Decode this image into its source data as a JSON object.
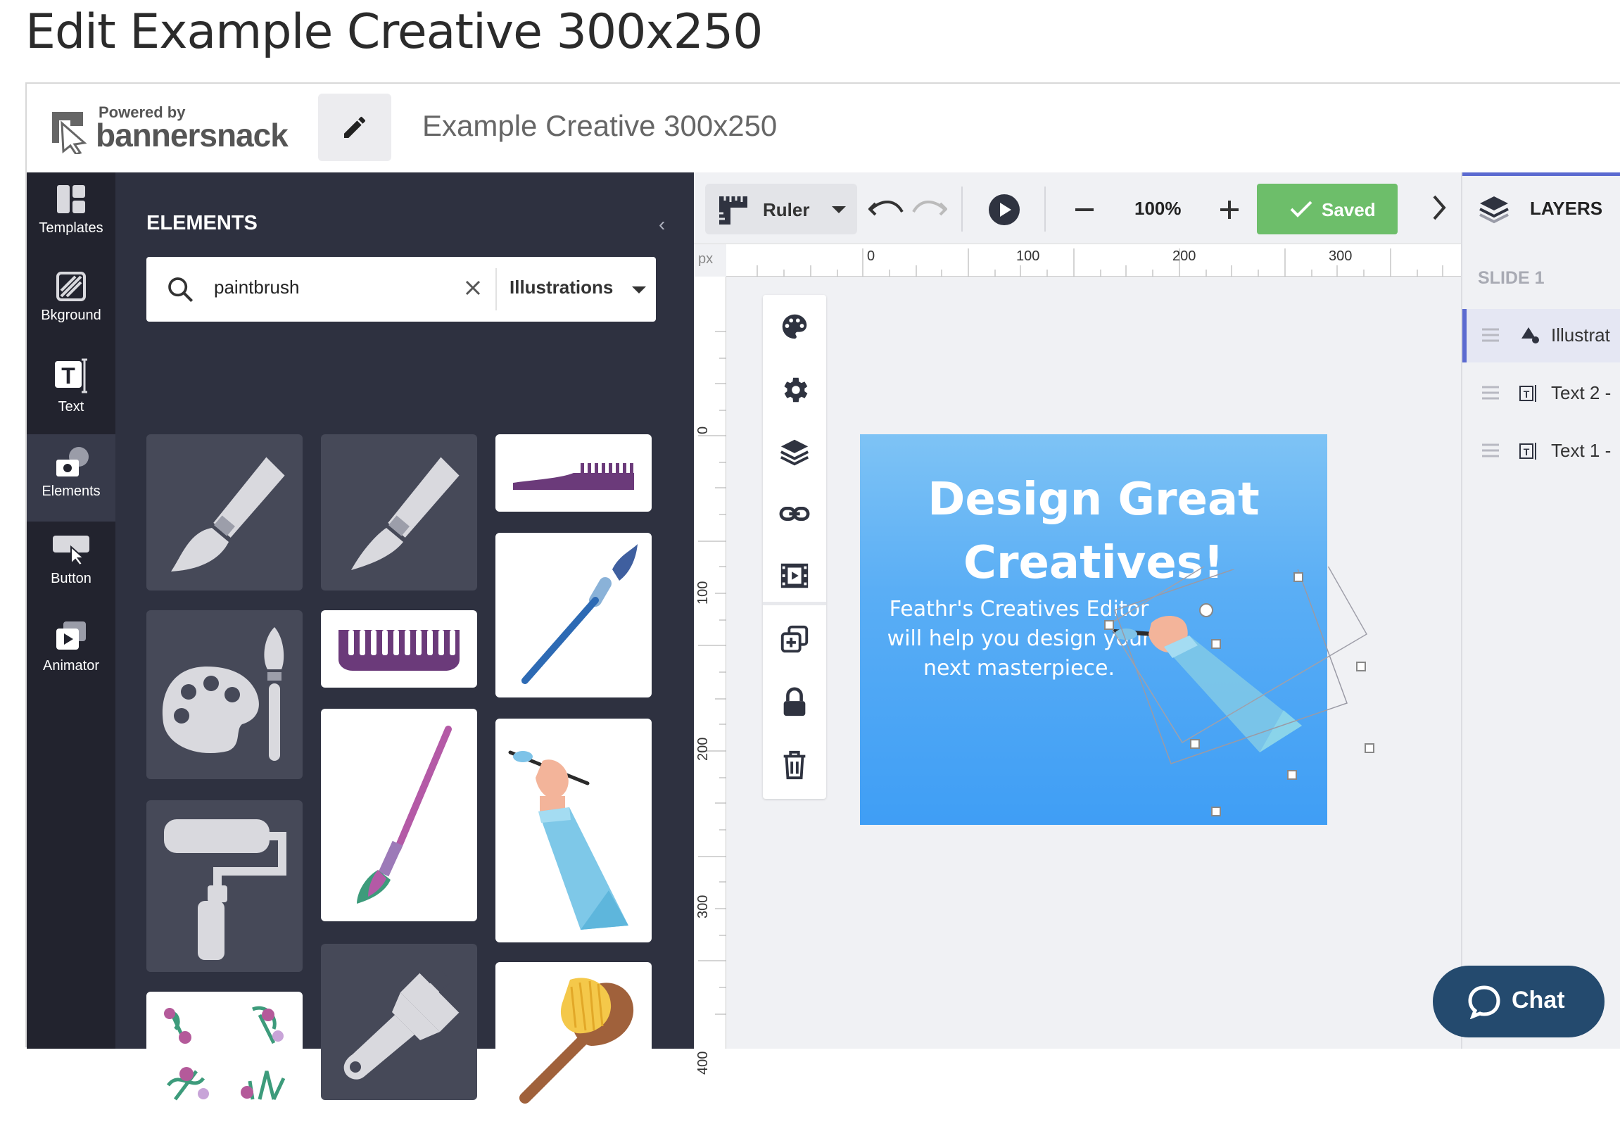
{
  "page": {
    "title": "Edit Example Creative 300x250"
  },
  "header": {
    "logo_powered": "Powered by",
    "logo_name": "bannersnack",
    "creative_name": "Example Creative 300x250"
  },
  "rail": {
    "items": [
      {
        "label": "Templates",
        "icon": "templates-icon"
      },
      {
        "label": "Bkground",
        "icon": "background-icon"
      },
      {
        "label": "Text",
        "icon": "text-icon"
      },
      {
        "label": "Elements",
        "icon": "elements-icon",
        "active": true
      },
      {
        "label": "Button",
        "icon": "button-icon"
      },
      {
        "label": "Animator",
        "icon": "animator-icon"
      }
    ]
  },
  "elements_panel": {
    "title": "ELEMENTS",
    "search_value": "paintbrush",
    "filter": "Illustrations"
  },
  "toolbar": {
    "ruler_label": "Ruler",
    "zoom": "100%",
    "saved_label": "Saved"
  },
  "rulers": {
    "unit": "px",
    "h_labels": [
      "0",
      "100",
      "200",
      "300"
    ],
    "v_labels": [
      "0",
      "100",
      "200",
      "300",
      "400"
    ]
  },
  "banner": {
    "title": "Design Great Creatives!",
    "subtitle": "Feathr's Creatives Editor will help you design your next masterpiece."
  },
  "layers": {
    "title": "LAYERS",
    "slide_label": "SLIDE 1",
    "items": [
      {
        "label": "Illustrat",
        "active": true
      },
      {
        "label": "Text 2 -"
      },
      {
        "label": "Text 1 -"
      }
    ]
  },
  "chat": {
    "label": "Chat"
  },
  "colors": {
    "rail_bg": "#22232e",
    "panel_bg": "#2e3140",
    "saved_green": "#6dbe6a",
    "accent": "#5b6ad0",
    "chat_bg": "#244a6e"
  }
}
